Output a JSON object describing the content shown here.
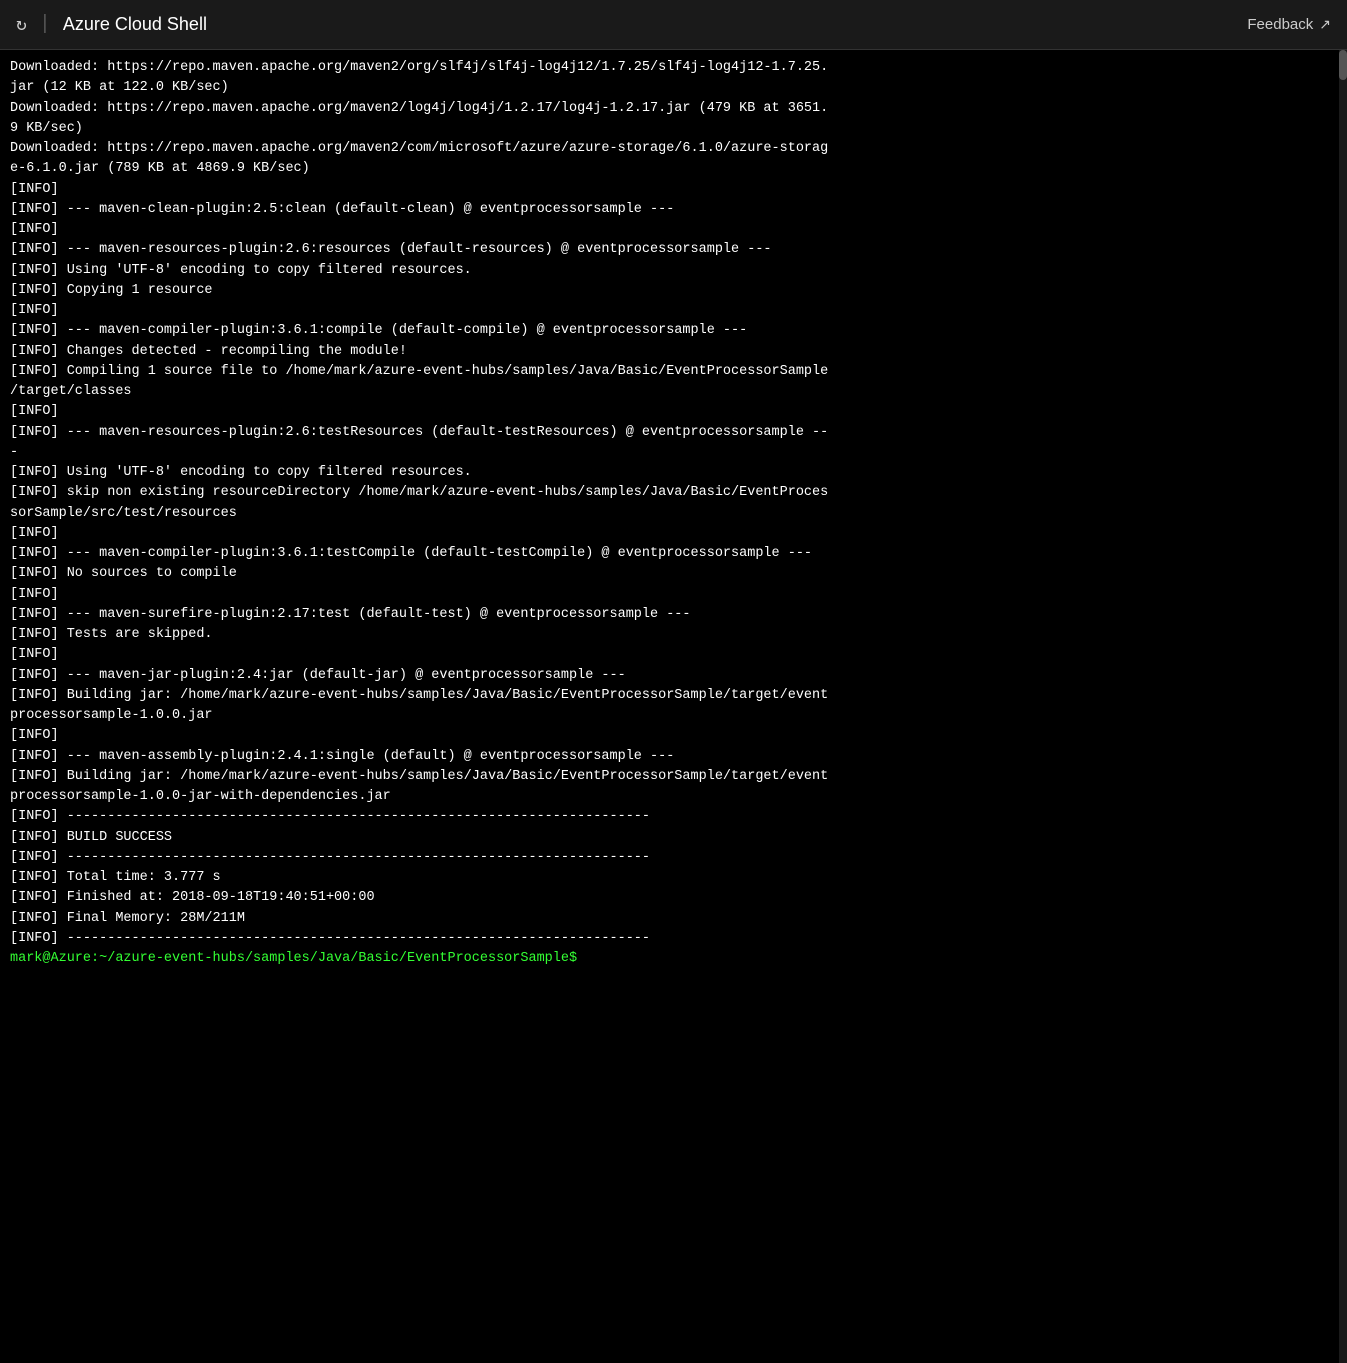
{
  "titlebar": {
    "title": "Azure Cloud Shell",
    "feedback_label": "Feedback",
    "refresh_icon": "↻",
    "divider": "|",
    "external_link_icon": "↗"
  },
  "terminal": {
    "lines": [
      "Downloaded: https://repo.maven.apache.org/maven2/org/slf4j/slf4j-log4j12/1.7.25/slf4j-log4j12-1.7.25.",
      "jar (12 KB at 122.0 KB/sec)",
      "Downloaded: https://repo.maven.apache.org/maven2/log4j/log4j/1.2.17/log4j-1.2.17.jar (479 KB at 3651.",
      "9 KB/sec)",
      "Downloaded: https://repo.maven.apache.org/maven2/com/microsoft/azure/azure-storage/6.1.0/azure-storag",
      "e-6.1.0.jar (789 KB at 4869.9 KB/sec)",
      "[INFO]",
      "[INFO] --- maven-clean-plugin:2.5:clean (default-clean) @ eventprocessorsample ---",
      "[INFO]",
      "[INFO] --- maven-resources-plugin:2.6:resources (default-resources) @ eventprocessorsample ---",
      "[INFO] Using 'UTF-8' encoding to copy filtered resources.",
      "[INFO] Copying 1 resource",
      "[INFO]",
      "[INFO] --- maven-compiler-plugin:3.6.1:compile (default-compile) @ eventprocessorsample ---",
      "[INFO] Changes detected - recompiling the module!",
      "[INFO] Compiling 1 source file to /home/mark/azure-event-hubs/samples/Java/Basic/EventProcessorSample",
      "/target/classes",
      "[INFO]",
      "[INFO] --- maven-resources-plugin:2.6:testResources (default-testResources) @ eventprocessorsample --",
      "-",
      "[INFO] Using 'UTF-8' encoding to copy filtered resources.",
      "[INFO] skip non existing resourceDirectory /home/mark/azure-event-hubs/samples/Java/Basic/EventProces",
      "sorSample/src/test/resources",
      "[INFO]",
      "[INFO] --- maven-compiler-plugin:3.6.1:testCompile (default-testCompile) @ eventprocessorsample ---",
      "[INFO] No sources to compile",
      "[INFO]",
      "[INFO] --- maven-surefire-plugin:2.17:test (default-test) @ eventprocessorsample ---",
      "[INFO] Tests are skipped.",
      "[INFO]",
      "[INFO] --- maven-jar-plugin:2.4:jar (default-jar) @ eventprocessorsample ---",
      "[INFO] Building jar: /home/mark/azure-event-hubs/samples/Java/Basic/EventProcessorSample/target/event",
      "processorsample-1.0.0.jar",
      "[INFO]",
      "[INFO] --- maven-assembly-plugin:2.4.1:single (default) @ eventprocessorsample ---",
      "[INFO] Building jar: /home/mark/azure-event-hubs/samples/Java/Basic/EventProcessorSample/target/event",
      "processorsample-1.0.0-jar-with-dependencies.jar",
      "[INFO] ------------------------------------------------------------------------",
      "[INFO] BUILD SUCCESS",
      "[INFO] ------------------------------------------------------------------------",
      "[INFO] Total time: 3.777 s",
      "[INFO] Finished at: 2018-09-18T19:40:51+00:00",
      "[INFO] Final Memory: 28M/211M",
      "[INFO] ------------------------------------------------------------------------"
    ],
    "prompt": "mark@Azure:~/azure-event-hubs/samples/Java/Basic/EventProcessorSample$"
  }
}
